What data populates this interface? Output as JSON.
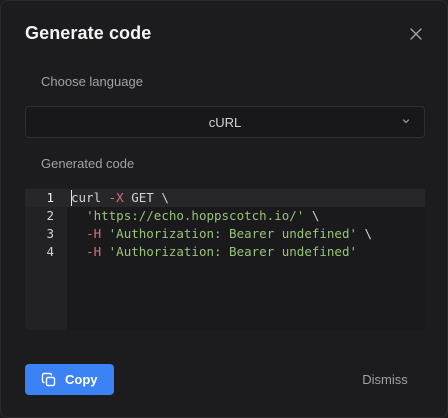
{
  "dialog": {
    "title": "Generate code",
    "close_icon": "close-icon"
  },
  "language": {
    "label": "Choose language",
    "selected": "cURL",
    "dropdown_icon": "chevron-down-icon"
  },
  "output": {
    "label": "Generated code",
    "lines": [
      {
        "number": "1",
        "plain": "curl ",
        "flag": "-X",
        "rest": " GET \\",
        "string": ""
      },
      {
        "number": "2",
        "plain": "  ",
        "flag": "",
        "rest": " \\",
        "string": "'https://echo.hoppscotch.io/'"
      },
      {
        "number": "3",
        "plain": "  ",
        "flag": "-H",
        "rest": " \\",
        "string": " 'Authorization: Bearer undefined'"
      },
      {
        "number": "4",
        "plain": "  ",
        "flag": "-H",
        "rest": "",
        "string": " 'Authorization: Bearer undefined'"
      }
    ]
  },
  "actions": {
    "copy_label": "Copy",
    "copy_icon": "copy-icon",
    "dismiss_label": "Dismiss"
  },
  "colors": {
    "accent": "#3b82f6",
    "string": "#98c379",
    "flag": "#e06c75"
  }
}
